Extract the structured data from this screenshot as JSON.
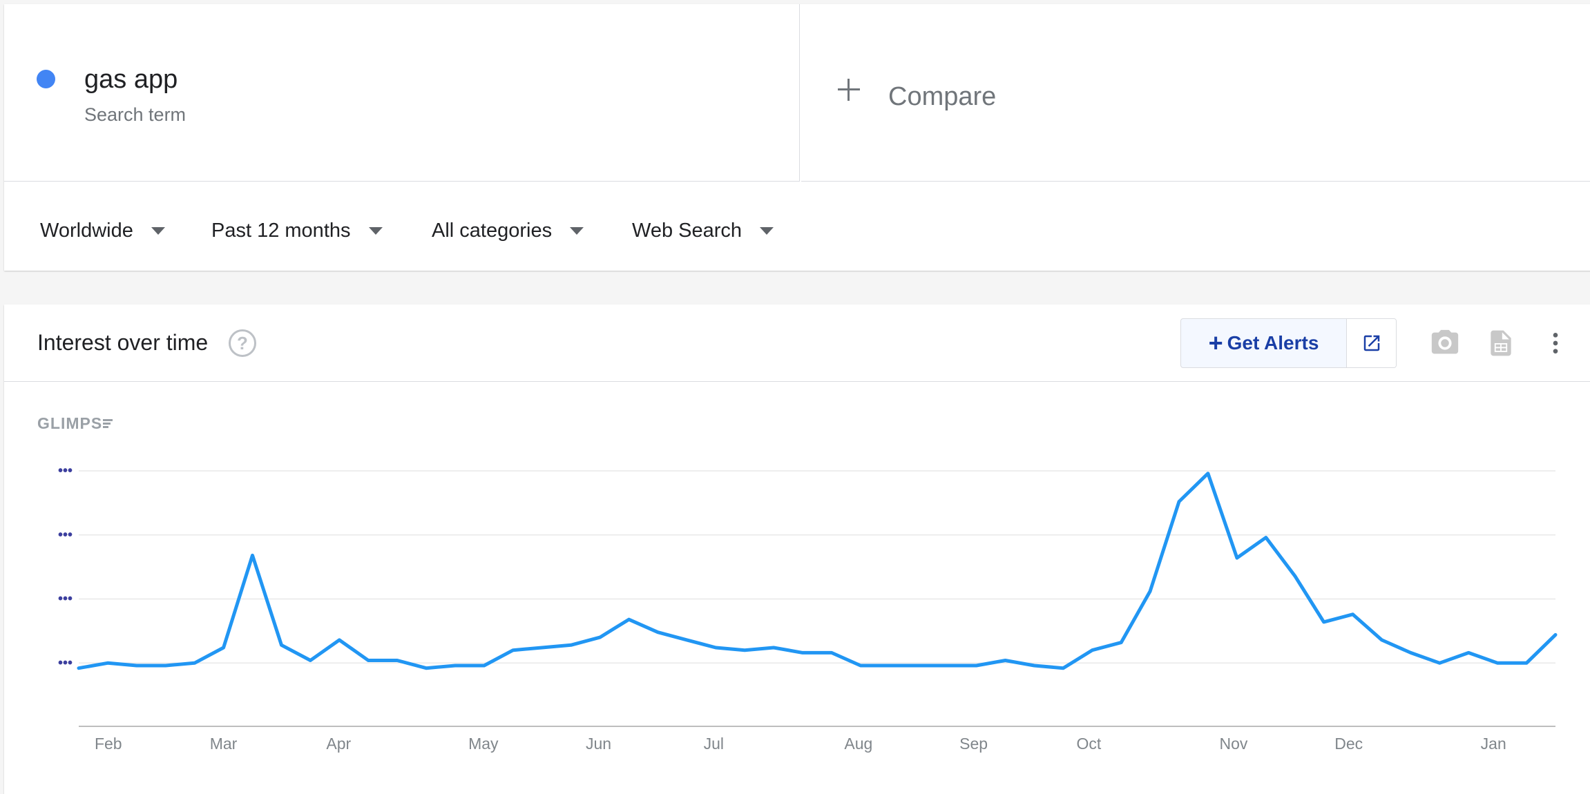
{
  "search_term": {
    "name": "gas app",
    "kind": "Search term",
    "color": "#4285f4"
  },
  "compare": {
    "label": "Compare"
  },
  "filters": [
    {
      "label": "Worldwide"
    },
    {
      "label": "Past 12 months"
    },
    {
      "label": "All categories"
    },
    {
      "label": "Web Search"
    }
  ],
  "interest_card": {
    "title": "Interest over time",
    "get_alerts_label": "Get Alerts",
    "logo_text": "GLIMPS"
  },
  "chart_data": {
    "type": "line",
    "x_labels": [
      "Feb",
      "Mar",
      "Apr",
      "May",
      "Jun",
      "Jul",
      "Aug",
      "Sep",
      "Oct",
      "Nov",
      "Dec",
      "Jan"
    ],
    "y_tick_labels": [
      "•••",
      "•••",
      "•••",
      "•••"
    ],
    "ylim": [
      0,
      100
    ],
    "grid": true,
    "series": [
      {
        "color": "#2196f3",
        "values": [
          23,
          25,
          24,
          24,
          25,
          31,
          67,
          32,
          26,
          34,
          26,
          26,
          23,
          24,
          24,
          30,
          31,
          32,
          35,
          42,
          37,
          34,
          31,
          30,
          31,
          29,
          29,
          24,
          24,
          24,
          24,
          24,
          26,
          24,
          23,
          30,
          33,
          53,
          88,
          99,
          66,
          74,
          59,
          41,
          44,
          34,
          29,
          25,
          29,
          25,
          25,
          36
        ]
      }
    ]
  }
}
